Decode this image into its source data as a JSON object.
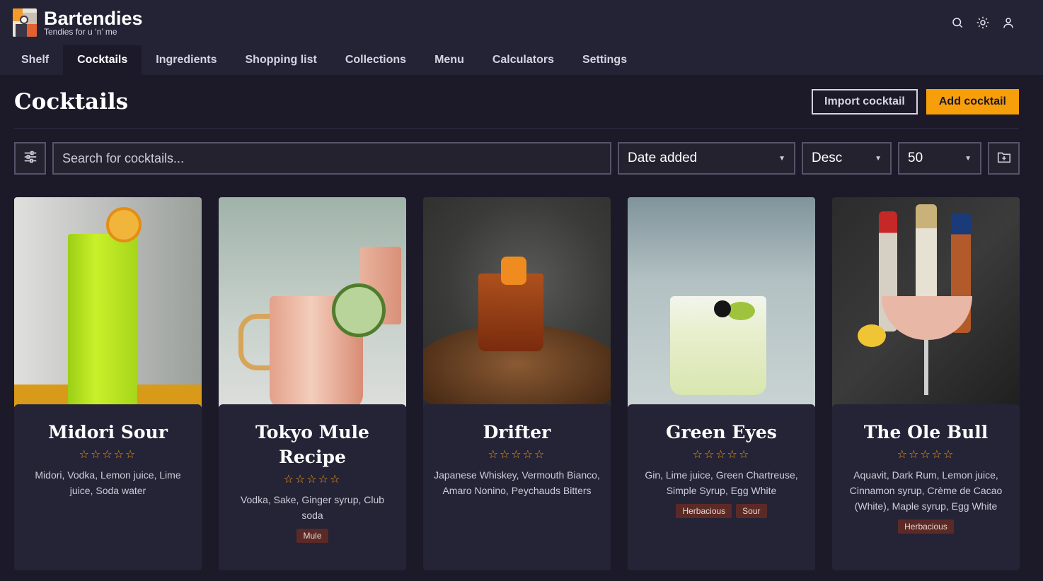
{
  "brand": {
    "name": "Bartendies",
    "tagline": "Tendies for u ‘n’ me"
  },
  "header_icons": [
    "search-icon",
    "sun-icon",
    "user-icon"
  ],
  "tabs": [
    {
      "label": "Shelf",
      "active": false
    },
    {
      "label": "Cocktails",
      "active": true
    },
    {
      "label": "Ingredients",
      "active": false
    },
    {
      "label": "Shopping list",
      "active": false
    },
    {
      "label": "Collections",
      "active": false
    },
    {
      "label": "Menu",
      "active": false
    },
    {
      "label": "Calculators",
      "active": false
    },
    {
      "label": "Settings",
      "active": false
    }
  ],
  "page": {
    "title": "Cocktails",
    "import_label": "Import cocktail",
    "add_label": "Add cocktail"
  },
  "filters": {
    "search_placeholder": "Search for cocktails...",
    "sort_by": "Date added",
    "sort_dir": "Desc",
    "per_page": "50"
  },
  "colors": {
    "accent": "#f79e0b",
    "background": "#1c1a29",
    "card": "#252336",
    "tag": "#5c2a26"
  },
  "cocktails": [
    {
      "name": "Midori Sour",
      "rating": "☆☆☆☆☆",
      "ingredients": "Midori, Vodka, Lemon juice, Lime juice, Soda water",
      "tags": []
    },
    {
      "name": "Tokyo Mule Recipe",
      "rating": "☆☆☆☆☆",
      "ingredients": "Vodka, Sake, Ginger syrup, Club soda",
      "tags": [
        "Mule"
      ]
    },
    {
      "name": "Drifter",
      "rating": "☆☆☆☆☆",
      "ingredients": "Japanese Whiskey, Vermouth Bianco, Amaro Nonino, Peychauds Bitters",
      "tags": []
    },
    {
      "name": "Green Eyes",
      "rating": "☆☆☆☆☆",
      "ingredients": "Gin, Lime juice, Green Chartreuse, Simple Syrup, Egg White",
      "tags": [
        "Herbacious",
        "Sour"
      ]
    },
    {
      "name": "The Ole Bull",
      "rating": "☆☆☆☆☆",
      "ingredients": "Aquavit, Dark Rum, Lemon juice, Cinnamon syrup, Crème de Cacao (White), Maple syrup, Egg White",
      "tags": [
        "Herbacious"
      ]
    }
  ]
}
